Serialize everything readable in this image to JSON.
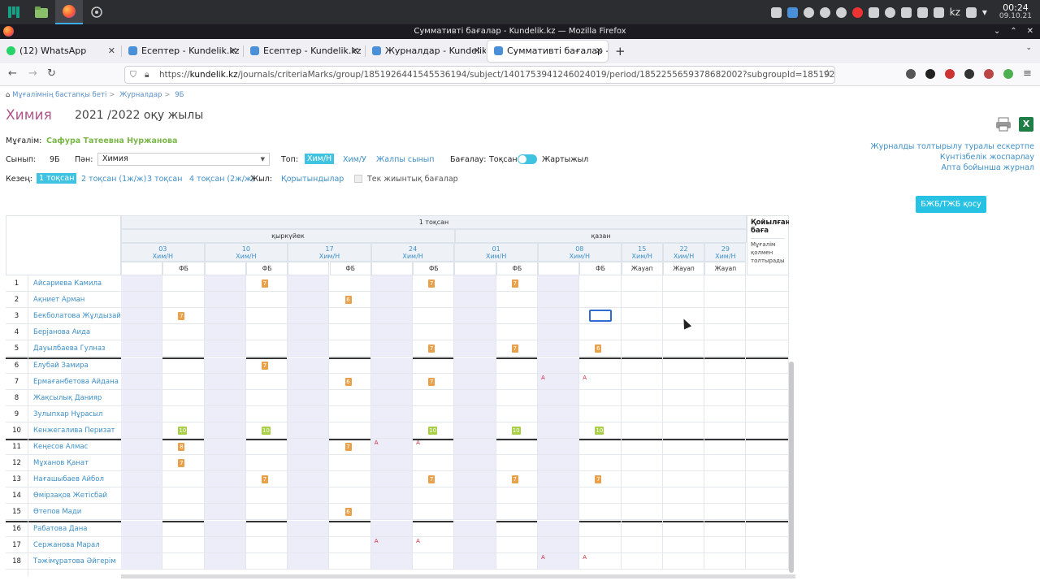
{
  "taskbar": {
    "tray_lang": "kz",
    "time": "00:24",
    "date": "09.10.21"
  },
  "window": {
    "title": "Суммативті бағалар - Kundelik.kz — Mozilla Firefox"
  },
  "tabs": [
    {
      "label": "(12) WhatsApp",
      "fav_color": "#25d366"
    },
    {
      "label": "Есептер - Kundelik.kz",
      "fav_color": "#4a90d9"
    },
    {
      "label": "Есептер - Kundelik.kz",
      "fav_color": "#4a90d9"
    },
    {
      "label": "Журналдар - Kundelik.kz",
      "fav_color": "#4a90d9"
    },
    {
      "label": "Суммативті бағалар - Ku",
      "fav_color": "#4a90d9"
    }
  ],
  "url": {
    "prefix": "https://",
    "domain": "kundelik.kz",
    "path": "/journals/criteriaMarks/group/1851926441545536194/subject/1401753941246024019/period/1852255659378682002?subgroupId=18519264415455362..."
  },
  "breadcrumb": [
    "Мұғалімнің бастапқы беті",
    "Журналдар",
    "9Б"
  ],
  "subject": "Химия",
  "year": "2021 /2022 оқу жылы",
  "teacher_label": "Мұғалім:",
  "teacher": "Сафура Татеевна Нуржанова",
  "filters": {
    "class_label": "Сынып:",
    "class_value": "9Б",
    "subject_label": "Пән:",
    "subject_value": "Химия",
    "group_label": "Топ:",
    "groups": [
      "Хим/Н",
      "Хим/У",
      "Жалпы сынып"
    ],
    "grading_label": "Бағалау:",
    "grading_left": "Тоқсан",
    "grading_right": "Жартыжыл",
    "period_label": "Кезең:",
    "periods": [
      "1 тоқсан",
      "2 тоқсан (1ж/ж)",
      "3 тоқсан",
      "4 тоқсан (2ж/ж)"
    ],
    "year_label": "Жыл:",
    "year_link": "Қорытындылар",
    "only_totals": "Тек жиынтық бағалар"
  },
  "right_links": [
    "Журналды толтырылу туралы ескертпе",
    "Күнтізбелік жоспарлау",
    "Апта бойынша журнал"
  ],
  "add_button": "БЖБ/ТЖБ қосу",
  "table": {
    "quarter": "1 тоқсан",
    "months": [
      "қыркүйек",
      "қазан"
    ],
    "dates": [
      {
        "day": "03",
        "group": "Хим/Н",
        "cols": [
          "",
          "ФБ"
        ]
      },
      {
        "day": "10",
        "group": "Хим/Н",
        "cols": [
          "",
          "ФБ"
        ]
      },
      {
        "day": "17",
        "group": "Хим/Н",
        "cols": [
          "",
          "ФБ"
        ]
      },
      {
        "day": "24",
        "group": "Хим/Н",
        "cols": [
          "",
          "ФБ"
        ]
      },
      {
        "day": "01",
        "group": "Хим/Н",
        "cols": [
          "",
          "ФБ"
        ]
      },
      {
        "day": "08",
        "group": "Хим/Н",
        "cols": [
          "",
          "ФБ"
        ]
      },
      {
        "day": "15",
        "group": "Хим/Н",
        "cols": [
          "Жауап"
        ]
      },
      {
        "day": "22",
        "group": "Хим/Н",
        "cols": [
          "Жауап"
        ]
      },
      {
        "day": "29",
        "group": "Хим/Н",
        "cols": [
          "Жауап"
        ]
      }
    ],
    "final_header": "Қойылған баға",
    "final_sub": "Мұғалім қолмен толтырады",
    "students": [
      {
        "n": "1",
        "name": "Айсариева Камила",
        "marks": [
          null,
          null,
          null,
          "7",
          null,
          null,
          null,
          "7",
          null,
          "7",
          null,
          null,
          null,
          null,
          null
        ]
      },
      {
        "n": "2",
        "name": "Ақниет Арман",
        "marks": [
          null,
          null,
          null,
          null,
          null,
          "6",
          null,
          null,
          null,
          null,
          null,
          null,
          null,
          null,
          null
        ]
      },
      {
        "n": "3",
        "name": "Бекболатова Жұлдызай",
        "marks": [
          null,
          "7",
          null,
          null,
          null,
          null,
          null,
          null,
          null,
          null,
          null,
          null,
          null,
          null,
          null
        ]
      },
      {
        "n": "4",
        "name": "Берjанова Аида",
        "marks": [
          null,
          null,
          null,
          null,
          null,
          null,
          null,
          null,
          null,
          null,
          null,
          null,
          null,
          null,
          null
        ]
      },
      {
        "n": "5",
        "name": "Дауылбаева Гулназ",
        "marks": [
          null,
          null,
          null,
          null,
          null,
          null,
          null,
          "7",
          null,
          "7",
          null,
          "6",
          null,
          null,
          null
        ]
      },
      {
        "n": "6",
        "name": "Елубай Замира",
        "marks": [
          null,
          null,
          null,
          "7",
          null,
          null,
          null,
          null,
          null,
          null,
          null,
          null,
          null,
          null,
          null
        ]
      },
      {
        "n": "7",
        "name": "Ермағанбетова Айдана",
        "marks": [
          null,
          null,
          null,
          null,
          null,
          "6",
          null,
          "7",
          null,
          null,
          "А",
          "А",
          null,
          null,
          null
        ]
      },
      {
        "n": "8",
        "name": "Жақсылық Данияр",
        "marks": [
          null,
          null,
          null,
          null,
          null,
          null,
          null,
          null,
          null,
          null,
          null,
          null,
          null,
          null,
          null
        ]
      },
      {
        "n": "9",
        "name": "Зулыпхар Нұрасыл",
        "marks": [
          null,
          null,
          null,
          null,
          null,
          null,
          null,
          null,
          null,
          null,
          null,
          null,
          null,
          null,
          null
        ]
      },
      {
        "n": "10",
        "name": "Кенжегалива Перизат",
        "marks": [
          null,
          "10",
          null,
          "10",
          null,
          null,
          null,
          "10",
          null,
          "10",
          null,
          "10",
          null,
          null,
          null
        ]
      },
      {
        "n": "11",
        "name": "Кеңесов Алмас",
        "marks": [
          null,
          "8",
          null,
          null,
          null,
          "7",
          "А",
          "А",
          null,
          null,
          null,
          null,
          null,
          null,
          null
        ]
      },
      {
        "n": "12",
        "name": "Мұханов Қанат",
        "marks": [
          null,
          "7",
          null,
          null,
          null,
          null,
          null,
          null,
          null,
          null,
          null,
          null,
          null,
          null,
          null
        ]
      },
      {
        "n": "13",
        "name": "Нағашыбаев Айбол",
        "marks": [
          null,
          null,
          null,
          "7",
          null,
          null,
          null,
          "7",
          null,
          "7",
          null,
          "7",
          null,
          null,
          null
        ]
      },
      {
        "n": "14",
        "name": "Өмірзақов Жетісбай",
        "marks": [
          null,
          null,
          null,
          null,
          null,
          null,
          null,
          null,
          null,
          null,
          null,
          null,
          null,
          null,
          null
        ]
      },
      {
        "n": "15",
        "name": "Өтепов Мади",
        "marks": [
          null,
          null,
          null,
          null,
          null,
          "6",
          null,
          null,
          null,
          null,
          null,
          null,
          null,
          null,
          null
        ]
      },
      {
        "n": "16",
        "name": "Рабатова Дана",
        "marks": [
          null,
          null,
          null,
          null,
          null,
          null,
          null,
          null,
          null,
          null,
          null,
          null,
          null,
          null,
          null
        ]
      },
      {
        "n": "17",
        "name": "Сержанова Марал",
        "marks": [
          null,
          null,
          null,
          null,
          null,
          null,
          "А",
          "А",
          null,
          null,
          null,
          null,
          null,
          null,
          null
        ]
      },
      {
        "n": "18",
        "name": "Тәжімұратова Әйгерім",
        "marks": [
          null,
          null,
          null,
          null,
          null,
          null,
          null,
          null,
          null,
          null,
          "А",
          "А",
          null,
          null,
          null
        ]
      }
    ]
  },
  "colors": {
    "mark_orange": "#e8a04b",
    "mark_green": "#a8cf45",
    "absent": "#d3263b",
    "accent": "#3fc3e0"
  }
}
